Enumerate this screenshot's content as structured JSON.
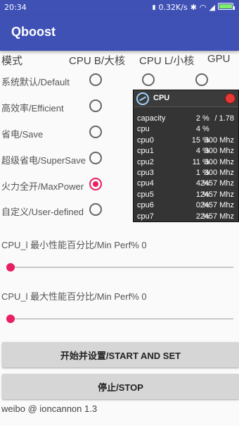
{
  "status_bar": {
    "time": "20:34",
    "speed": "0.32K/s",
    "icons": [
      "sim-icon",
      "bluetooth-icon",
      "wifi-icon",
      "signal-icon",
      "battery-icon"
    ]
  },
  "app": {
    "title": "Qboost"
  },
  "columns": {
    "mode": "模式",
    "cpu_big": "CPU B/大核",
    "cpu_little": "CPU L/小核",
    "gpu": "GPU"
  },
  "modes": [
    {
      "label": "系统默认/Default",
      "selected": false
    },
    {
      "label": "高效率/Efficient",
      "selected": false
    },
    {
      "label": "省电/Save",
      "selected": false
    },
    {
      "label": "超级省电/SuperSave",
      "selected": false
    },
    {
      "label": "火力全开/MaxPower",
      "selected": true
    },
    {
      "label": "自定义/User-defined",
      "selected": false
    }
  ],
  "sliders": {
    "min": {
      "label": "CPU_l 最小性能百分比/Min Perf% 0",
      "value": 0
    },
    "max": {
      "label": "CPU_l 最大性能百分比/Min Perf% 0",
      "value": 0
    }
  },
  "buttons": {
    "start": "开始并设置/START AND SET",
    "stop": "停止/STOP"
  },
  "footer": "weibo @ ioncannon 1.3",
  "overlay": {
    "title": "CPU",
    "rows": [
      {
        "name": "capacity",
        "pct": "2",
        "unit": "%",
        "freq": "/ 1.78"
      },
      {
        "name": "cpu",
        "pct": "4",
        "unit": "%",
        "freq": ""
      },
      {
        "name": "cpu0",
        "pct": "15",
        "unit": "%",
        "freq": "300 Mhz"
      },
      {
        "name": "cpu1",
        "pct": "4",
        "unit": "%",
        "freq": "300 Mhz"
      },
      {
        "name": "cpu2",
        "pct": "11",
        "unit": "%",
        "freq": "300 Mhz"
      },
      {
        "name": "cpu3",
        "pct": "1",
        "unit": "%",
        "freq": "300 Mhz"
      },
      {
        "name": "cpu4",
        "pct": "4",
        "unit": "%",
        "freq": "2457 Mhz"
      },
      {
        "name": "cpu5",
        "pct": "1",
        "unit": "%",
        "freq": "2457 Mhz"
      },
      {
        "name": "cpu6",
        "pct": "0",
        "unit": "%",
        "freq": "2457 Mhz"
      },
      {
        "name": "cpu7",
        "pct": "2",
        "unit": "%",
        "freq": "2457 Mhz"
      }
    ]
  },
  "colors": {
    "primary": "#3f51b5",
    "accent": "#e91e63"
  }
}
